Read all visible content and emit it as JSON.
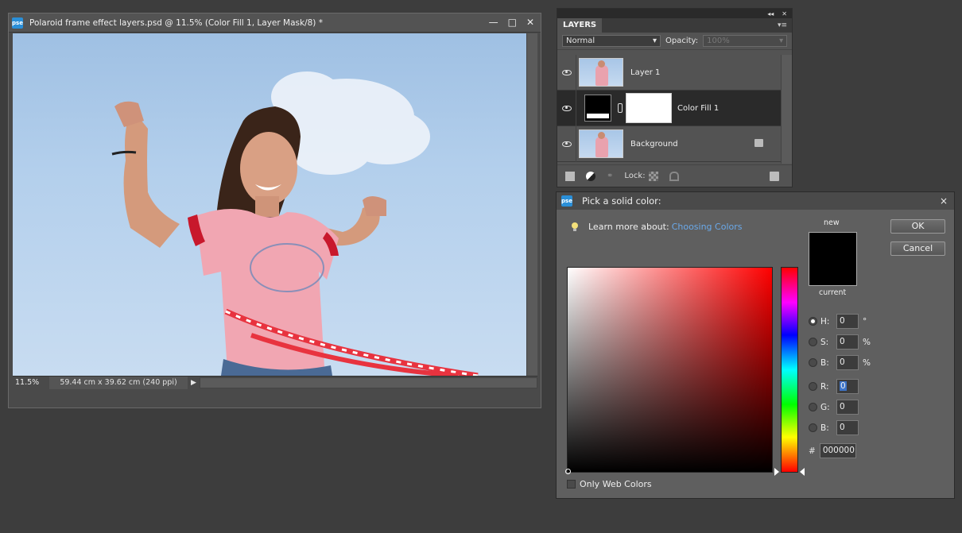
{
  "document": {
    "title": "Polaroid frame effect layers.psd @ 11.5% (Color Fill 1, Layer Mask/8) *",
    "app_badge": "pse",
    "zoom": "11.5%",
    "doc_size": "59.44 cm x 39.62 cm (240 ppi)",
    "window_buttons": [
      "—",
      "□",
      "✕"
    ]
  },
  "layers_panel": {
    "tab": "LAYERS",
    "collapse_glyph": "◂◂",
    "close_glyph": "✕",
    "blend_mode": "Normal",
    "opacity_label": "Opacity:",
    "opacity_value": "100%",
    "layers": [
      {
        "name": "Layer 1",
        "visible": true,
        "selected": false
      },
      {
        "name": "Color Fill 1",
        "visible": true,
        "selected": true
      },
      {
        "name": "Background",
        "visible": true,
        "selected": false,
        "locked": true
      }
    ],
    "lock_label": "Lock:"
  },
  "color_picker": {
    "title": "Pick a solid color:",
    "app_badge": "pse",
    "learn_text": "Learn more about:",
    "learn_link": "Choosing Colors",
    "new_label": "new",
    "current_label": "current",
    "ok_label": "OK",
    "cancel_label": "Cancel",
    "only_web_colors": "Only Web Colors",
    "fields": {
      "H": {
        "label": "H:",
        "value": "0",
        "unit": "°"
      },
      "S": {
        "label": "S:",
        "value": "0",
        "unit": "%"
      },
      "Bri": {
        "label": "B:",
        "value": "0",
        "unit": "%"
      },
      "R": {
        "label": "R:",
        "value": "0"
      },
      "G": {
        "label": "G:",
        "value": "0"
      },
      "Blue": {
        "label": "B:",
        "value": "0"
      }
    },
    "hex_label": "#",
    "hex_value": "000000",
    "swatch_color": "#000000"
  }
}
